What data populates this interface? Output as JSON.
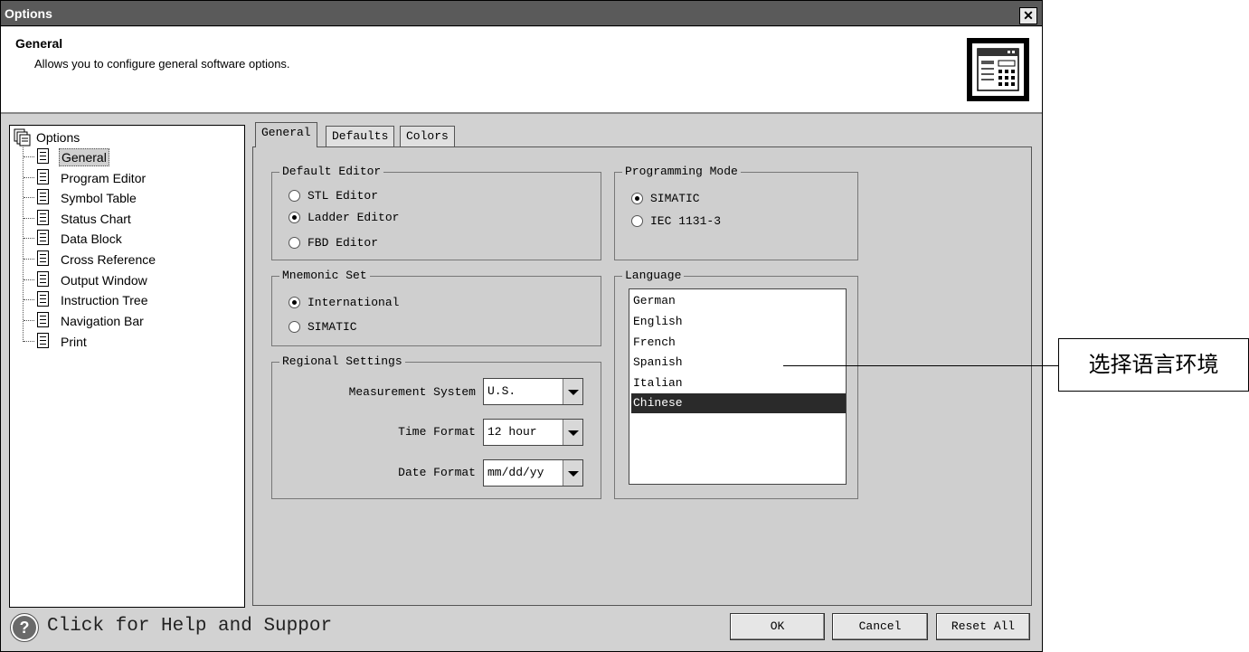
{
  "window": {
    "title": "Options",
    "close_glyph": "✕"
  },
  "header": {
    "title": "General",
    "description": "Allows you to configure general software options.",
    "icon": "settings-window-icon"
  },
  "tree": {
    "root": "Options",
    "items": [
      {
        "label": "General",
        "selected": true
      },
      {
        "label": "Program Editor"
      },
      {
        "label": "Symbol Table"
      },
      {
        "label": "Status Chart"
      },
      {
        "label": "Data Block"
      },
      {
        "label": "Cross Reference"
      },
      {
        "label": "Output Window"
      },
      {
        "label": "Instruction Tree"
      },
      {
        "label": "Navigation Bar"
      },
      {
        "label": "Print"
      }
    ]
  },
  "tabs": [
    {
      "label": "General",
      "active": true
    },
    {
      "label": "Defaults"
    },
    {
      "label": "Colors"
    }
  ],
  "default_editor": {
    "title": "Default Editor",
    "options": [
      {
        "label": "STL Editor",
        "selected": false
      },
      {
        "label": "Ladder Editor",
        "selected": true
      },
      {
        "label": "FBD Editor",
        "selected": false
      }
    ]
  },
  "programming_mode": {
    "title": "Programming Mode",
    "options": [
      {
        "label": "SIMATIC",
        "selected": true
      },
      {
        "label": "IEC 1131-3",
        "selected": false
      }
    ]
  },
  "mnemonic_set": {
    "title": "Mnemonic Set",
    "options": [
      {
        "label": "International",
        "selected": true
      },
      {
        "label": "SIMATIC",
        "selected": false
      }
    ]
  },
  "regional": {
    "title": "Regional Settings",
    "measurement_label": "Measurement System",
    "measurement_value": "U.S.",
    "time_label": "Time Format",
    "time_value": "12 hour",
    "date_label": "Date Format",
    "date_value": "mm/dd/yy"
  },
  "language": {
    "title": "Language",
    "items": [
      "German",
      "English",
      "French",
      "Spanish",
      "Italian",
      "Chinese"
    ],
    "selected": "Chinese"
  },
  "footer": {
    "help_glyph": "?",
    "help_text": "Click for Help and Suppor",
    "ok": "OK",
    "cancel": "Cancel",
    "reset": "Reset All"
  },
  "annotation": {
    "text": "选择语言环境"
  }
}
